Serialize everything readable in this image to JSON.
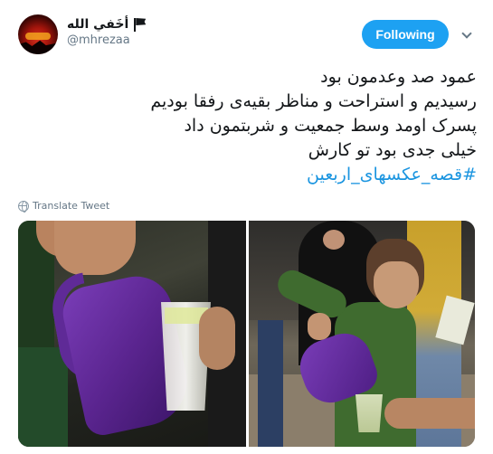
{
  "user": {
    "display_name": "أخَفي الله",
    "handle": "@mhrezaa",
    "flag_icon": "black-flag-icon",
    "avatar_icon": "sunset-avatar"
  },
  "actions": {
    "follow_label": "Following",
    "follow_color": "#1da1f2",
    "menu_icon": "chevron-down-icon"
  },
  "tweet": {
    "lines": [
      "عمود صد وعدمون بود",
      "رسیدیم و استراحت و مناظر بقیه‌ی رفقا بودیم",
      "پسرک اومد وسط جمعیت و شربتمون داد",
      "خیلی جدی بود تو کارش"
    ],
    "hashtag": "#قصه_عکسهای_اربعین",
    "hashtag_color": "#1b95e0"
  },
  "translate": {
    "label": "Translate Tweet",
    "icon": "globe-icon"
  }
}
